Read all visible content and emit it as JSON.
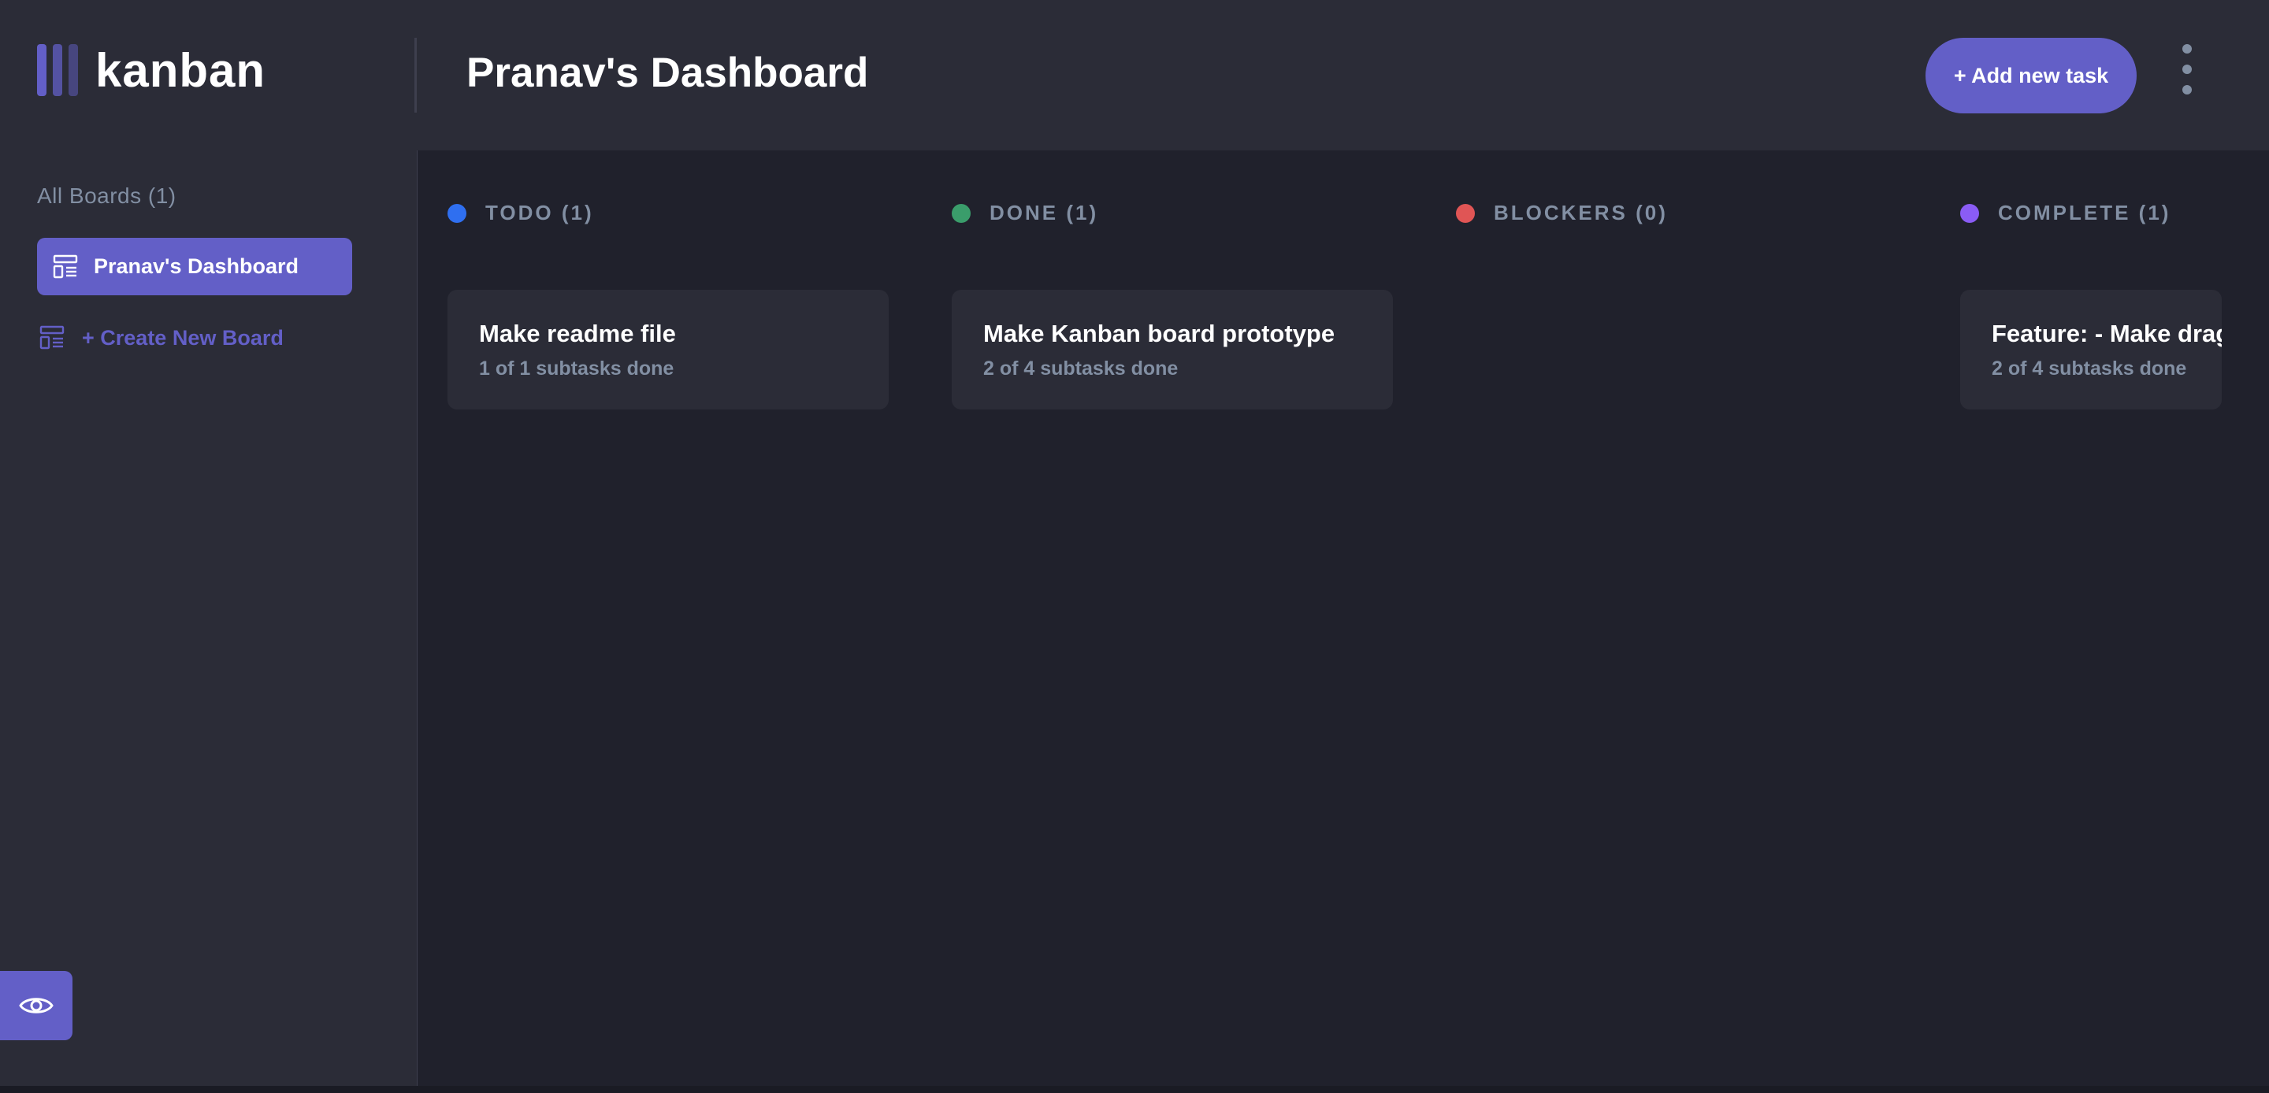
{
  "app": {
    "logo_text": "kanban"
  },
  "header": {
    "board_title": "Pranav's Dashboard",
    "add_task_label": "+ Add new task"
  },
  "sidebar": {
    "all_boards_label": "All Boards (1)",
    "boards": [
      {
        "label": "Pranav's Dashboard",
        "active": true
      }
    ],
    "create_board_label": "+ Create New Board"
  },
  "columns": [
    {
      "title": "TODO (1)",
      "color": "#2f6ff0",
      "cards": [
        {
          "title": "Make readme file",
          "subtitle": "1 of 1 subtasks done"
        }
      ]
    },
    {
      "title": "DONE (1)",
      "color": "#3a9d6b",
      "cards": [
        {
          "title": "Make Kanban board prototype",
          "subtitle": "2 of 4 subtasks done"
        }
      ]
    },
    {
      "title": "BLOCKERS (0)",
      "color": "#e05555",
      "cards": []
    },
    {
      "title": "COMPLETE (1)",
      "color": "#8a5cf5",
      "cards": [
        {
          "title": "Feature: - Make drag",
          "subtitle": "2 of 4 subtasks done"
        }
      ]
    }
  ],
  "colors": {
    "accent": "#635fc7",
    "background_dark": "#20212c",
    "panel": "#2b2c37",
    "muted_text": "#828fa3"
  },
  "icons": {
    "logo": "kanban-bars-icon",
    "board": "board-layout-icon",
    "menu": "kebab-menu-icon",
    "sidebar_toggle": "eye-icon"
  }
}
